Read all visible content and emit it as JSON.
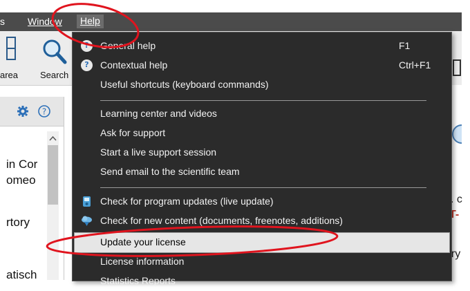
{
  "menubar": {
    "items": [
      {
        "label": "s"
      },
      {
        "label": "Window"
      },
      {
        "label": "Help"
      }
    ]
  },
  "toolbar": {
    "area_label": "area",
    "search_label": "Search"
  },
  "left_panel": {
    "lines": [
      "in Cor",
      "omeo",
      "rtory",
      "atisch"
    ]
  },
  "right_fragments": {
    "a": "c. c",
    "b": "T-",
    "c": "ory"
  },
  "help_menu": {
    "items": [
      {
        "label": "General help",
        "shortcut": "F1",
        "icon": "help-circle-icon"
      },
      {
        "label": "Contextual help",
        "shortcut": "Ctrl+F1",
        "icon": "help-circle-icon"
      },
      {
        "label": "Useful shortcuts (keyboard commands)"
      },
      {
        "label": "Learning center and videos"
      },
      {
        "label": "Ask for support"
      },
      {
        "label": "Start a live support session"
      },
      {
        "label": "Send email to the scientific team"
      },
      {
        "label": "Check for program updates (live update)",
        "icon": "update-icon"
      },
      {
        "label": "Check for new content (documents, freenotes, additions)",
        "icon": "download-cloud-icon"
      },
      {
        "label": "Update your license"
      },
      {
        "label": "License information"
      },
      {
        "label": "Statistics Reports"
      }
    ]
  },
  "colors": {
    "menubar_bg": "#4b4b4b",
    "menu_bg": "#2b2b2b",
    "highlight_bg": "#e6e6e6",
    "annotation": "#e0141e",
    "accent_blue": "#2b6fb8"
  }
}
